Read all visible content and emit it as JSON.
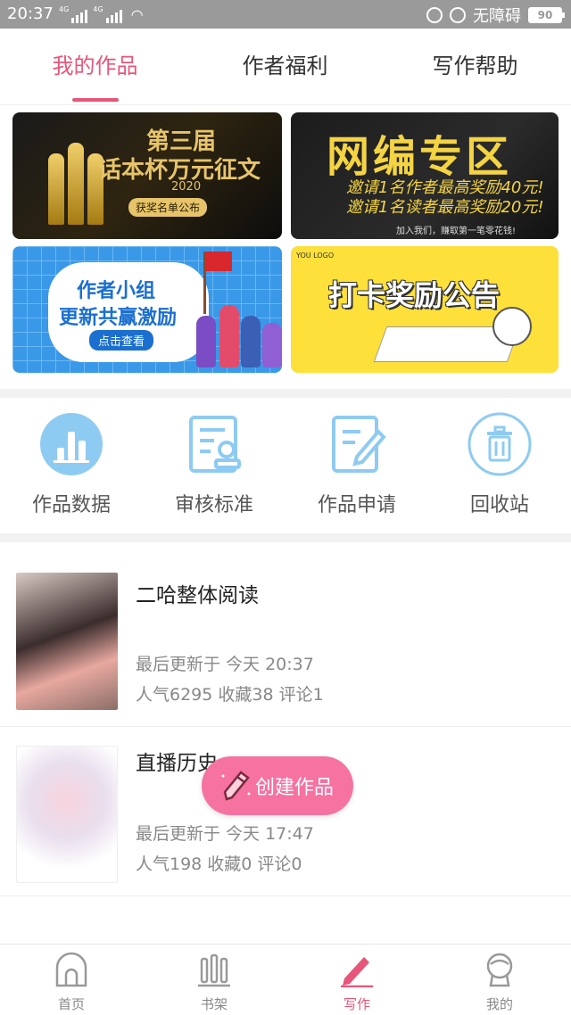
{
  "status_bar": {
    "time": "20:37",
    "network": "4G",
    "accessibility": "无障碍",
    "battery": "90"
  },
  "tabs": [
    {
      "label": "我的作品",
      "active": true
    },
    {
      "label": "作者福利",
      "active": false
    },
    {
      "label": "写作帮助",
      "active": false
    }
  ],
  "banners": {
    "contest": {
      "line1": "第三届",
      "line2": "话本杯万元征文",
      "year": "2020",
      "button": "获奖名单公布"
    },
    "editor": {
      "title": "网编专区",
      "line1": "邀请1名作者最高奖励40元!",
      "line2": "邀请1名读者最高奖励20元!",
      "footer": "加入我们，赚取第一笔零花钱!"
    },
    "group": {
      "line1": "作者小组",
      "line2": "更新共赢激励",
      "button": "点击查看"
    },
    "checkin": {
      "logo": "YOU LOGO",
      "title": "打卡奖励公告"
    }
  },
  "quick_actions": [
    {
      "label": "作品数据",
      "icon": "bar-chart-icon"
    },
    {
      "label": "审核标准",
      "icon": "review-document-icon"
    },
    {
      "label": "作品申请",
      "icon": "edit-document-icon"
    },
    {
      "label": "回收站",
      "icon": "trash-icon"
    }
  ],
  "works": [
    {
      "title": "二哈整体阅读",
      "updated": "最后更新于 今天 20:37",
      "stats": "人气6295 收藏38 评论1"
    },
    {
      "title": "直播历史",
      "updated": "最后更新于 今天 17:47",
      "stats": "人气198 收藏0 评论0"
    }
  ],
  "fab": {
    "label": "创建作品"
  },
  "bottom_nav": [
    {
      "label": "首页",
      "icon": "home-icon",
      "active": false
    },
    {
      "label": "书架",
      "icon": "bookshelf-icon",
      "active": false
    },
    {
      "label": "写作",
      "icon": "pen-icon",
      "active": true
    },
    {
      "label": "我的",
      "icon": "profile-icon",
      "active": false
    }
  ],
  "colors": {
    "accent": "#e7567a",
    "fab": "#f572a1",
    "icon_blue": "#8ecbf2"
  }
}
